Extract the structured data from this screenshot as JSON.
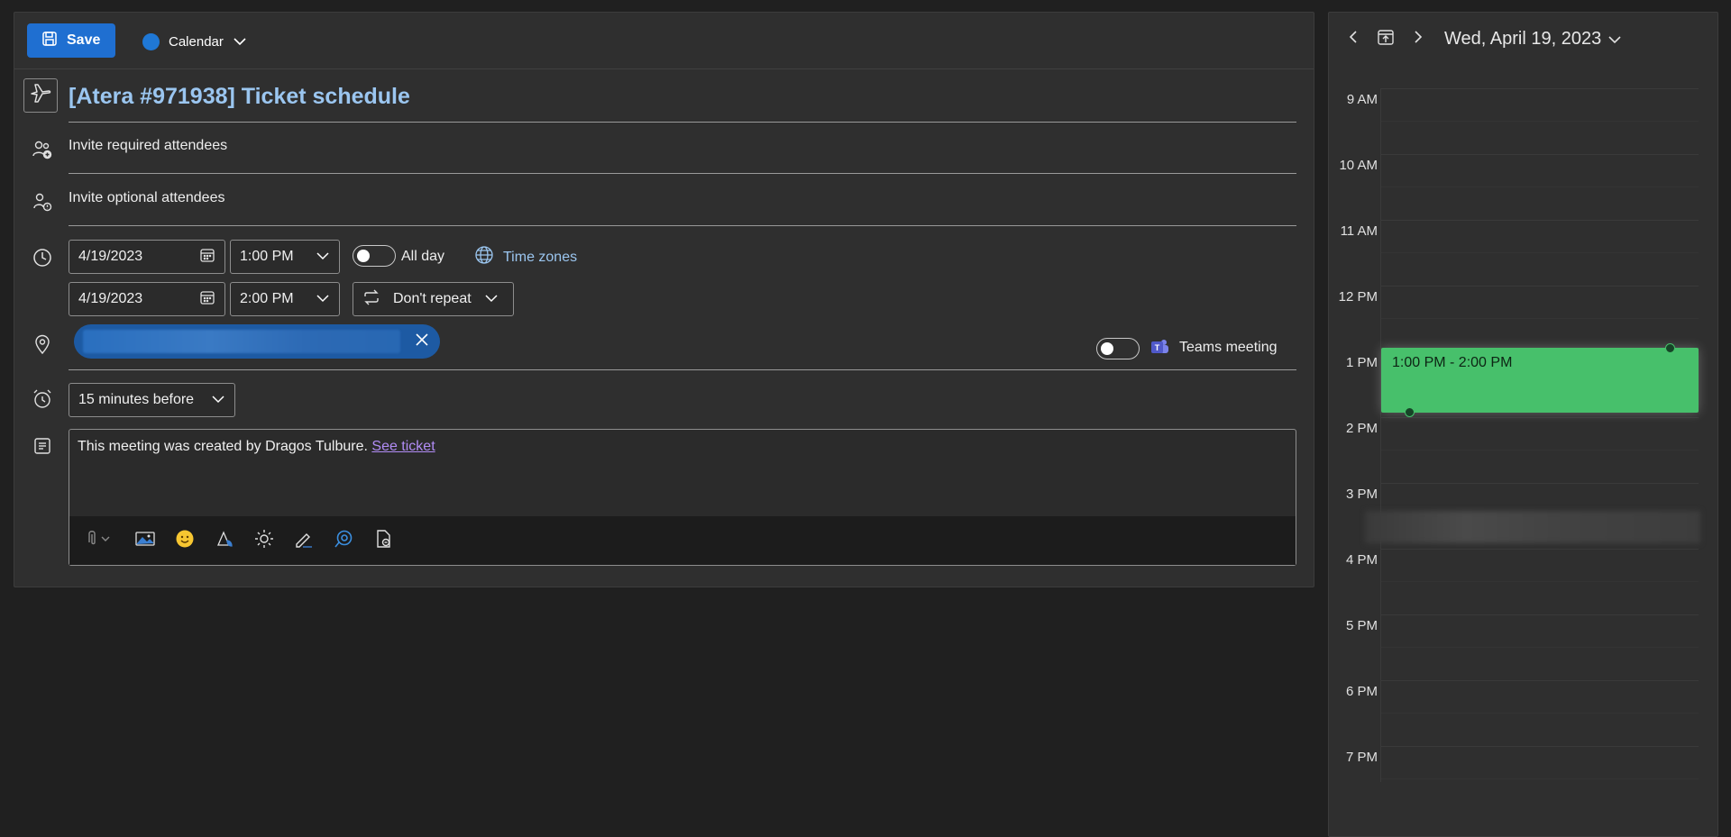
{
  "toolbar": {
    "save_label": "Save",
    "calendar_name": "Calendar"
  },
  "event": {
    "title": "[Atera #971938] Ticket schedule",
    "required_attendees_placeholder": "Invite required attendees",
    "optional_attendees_placeholder": "Invite optional attendees",
    "start_date": "4/19/2023",
    "start_time": "1:00 PM",
    "end_date": "4/19/2023",
    "end_time": "2:00 PM",
    "all_day_label": "All day",
    "all_day": false,
    "time_zones_label": "Time zones",
    "repeat_label": "Don't repeat",
    "teams_meeting_label": "Teams meeting",
    "teams_meeting": false,
    "reminder": "15 minutes before",
    "body_text": "This meeting was created by Dragos Tulbure.",
    "body_link": "See ticket"
  },
  "calendar_view": {
    "date_label": "Wed, April 19, 2023",
    "hours": [
      "9 AM",
      "10 AM",
      "11 AM",
      "12 PM",
      "1 PM",
      "2 PM",
      "3 PM",
      "4 PM",
      "5 PM",
      "6 PM",
      "7 PM"
    ],
    "event_time_label": "1:00 PM - 2:00 PM",
    "event_color": "#47c06b"
  },
  "colors": {
    "accent": "#1f6fd1",
    "title": "#9bc6f0",
    "link": "#b18cf5",
    "calendar_dot": "#1f78d6"
  }
}
